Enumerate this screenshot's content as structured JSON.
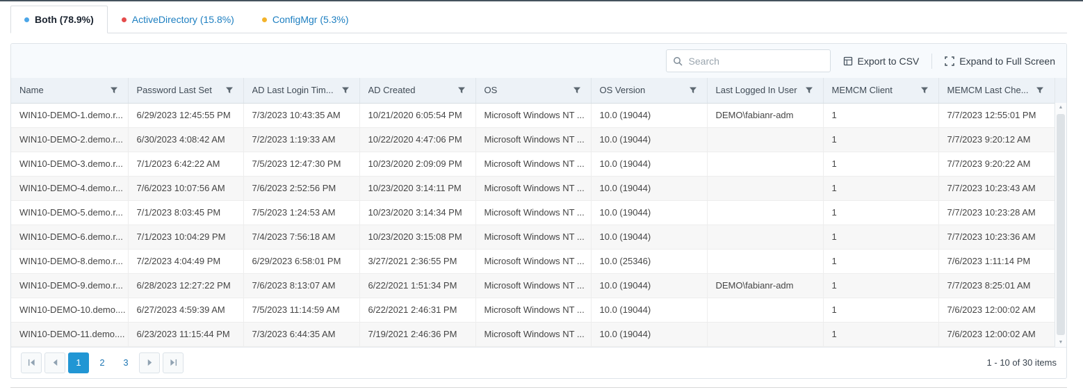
{
  "tabs": [
    {
      "label": "Both (78.9%)",
      "dot_color": "#4ba6e8",
      "active": true
    },
    {
      "label": "ActiveDirectory (15.8%)",
      "dot_color": "#e54b4b",
      "active": false
    },
    {
      "label": "ConfigMgr (5.3%)",
      "dot_color": "#f3b32b",
      "active": false
    }
  ],
  "toolbar": {
    "search_placeholder": "Search",
    "export_label": "Export to CSV",
    "fullscreen_label": "Expand to Full Screen"
  },
  "table": {
    "columns": [
      "Name",
      "Password Last Set",
      "AD Last Login Tim...",
      "AD Created",
      "OS",
      "OS Version",
      "Last Logged In User",
      "MEMCM Client",
      "MEMCM Last Che..."
    ],
    "rows": [
      [
        "WIN10-DEMO-1.demo.r...",
        "6/29/2023 12:45:55 PM",
        "7/3/2023 10:43:35 AM",
        "10/21/2020 6:05:54 PM",
        "Microsoft Windows NT ...",
        "10.0 (19044)",
        "DEMO\\fabianr-adm",
        "1",
        "7/7/2023 12:55:01 PM"
      ],
      [
        "WIN10-DEMO-2.demo.r...",
        "6/30/2023 4:08:42 AM",
        "7/2/2023 1:19:33 AM",
        "10/22/2020 4:47:06 PM",
        "Microsoft Windows NT ...",
        "10.0 (19044)",
        "",
        "1",
        "7/7/2023 9:20:12 AM"
      ],
      [
        "WIN10-DEMO-3.demo.r...",
        "7/1/2023 6:42:22 AM",
        "7/5/2023 12:47:30 PM",
        "10/23/2020 2:09:09 PM",
        "Microsoft Windows NT ...",
        "10.0 (19044)",
        "",
        "1",
        "7/7/2023 9:20:22 AM"
      ],
      [
        "WIN10-DEMO-4.demo.r...",
        "7/6/2023 10:07:56 AM",
        "7/6/2023 2:52:56 PM",
        "10/23/2020 3:14:11 PM",
        "Microsoft Windows NT ...",
        "10.0 (19044)",
        "",
        "1",
        "7/7/2023 10:23:43 AM"
      ],
      [
        "WIN10-DEMO-5.demo.r...",
        "7/1/2023 8:03:45 PM",
        "7/5/2023 1:24:53 AM",
        "10/23/2020 3:14:34 PM",
        "Microsoft Windows NT ...",
        "10.0 (19044)",
        "",
        "1",
        "7/7/2023 10:23:28 AM"
      ],
      [
        "WIN10-DEMO-6.demo.r...",
        "7/1/2023 10:04:29 PM",
        "7/4/2023 7:56:18 AM",
        "10/23/2020 3:15:08 PM",
        "Microsoft Windows NT ...",
        "10.0 (19044)",
        "",
        "1",
        "7/7/2023 10:23:36 AM"
      ],
      [
        "WIN10-DEMO-8.demo.r...",
        "7/2/2023 4:04:49 PM",
        "6/29/2023 6:58:01 PM",
        "3/27/2021 2:36:55 PM",
        "Microsoft Windows NT ...",
        "10.0 (25346)",
        "",
        "1",
        "7/6/2023 1:11:14 PM"
      ],
      [
        "WIN10-DEMO-9.demo.r...",
        "6/28/2023 12:27:22 PM",
        "7/6/2023 8:13:07 AM",
        "6/22/2021 1:51:34 PM",
        "Microsoft Windows NT ...",
        "10.0 (19044)",
        "DEMO\\fabianr-adm",
        "1",
        "7/7/2023 8:25:01 AM"
      ],
      [
        "WIN10-DEMO-10.demo....",
        "6/27/2023 4:59:39 AM",
        "7/5/2023 11:14:59 AM",
        "6/22/2021 2:46:31 PM",
        "Microsoft Windows NT ...",
        "10.0 (19044)",
        "",
        "1",
        "7/6/2023 12:00:02 AM"
      ],
      [
        "WIN10-DEMO-11.demo....",
        "6/23/2023 11:15:44 PM",
        "7/3/2023 6:44:35 AM",
        "7/19/2021 2:46:36 PM",
        "Microsoft Windows NT ...",
        "10.0 (19044)",
        "",
        "1",
        "7/6/2023 12:00:02 AM"
      ]
    ]
  },
  "pagination": {
    "pages": [
      "1",
      "2",
      "3"
    ],
    "active_page": "1",
    "info": "1 - 10 of 30 items"
  },
  "colors": {
    "accent_blue": "#2196d4",
    "link_blue": "#1d7fc1",
    "header_bg": "#edf2f7",
    "toolbar_bg": "#f7fafd"
  }
}
